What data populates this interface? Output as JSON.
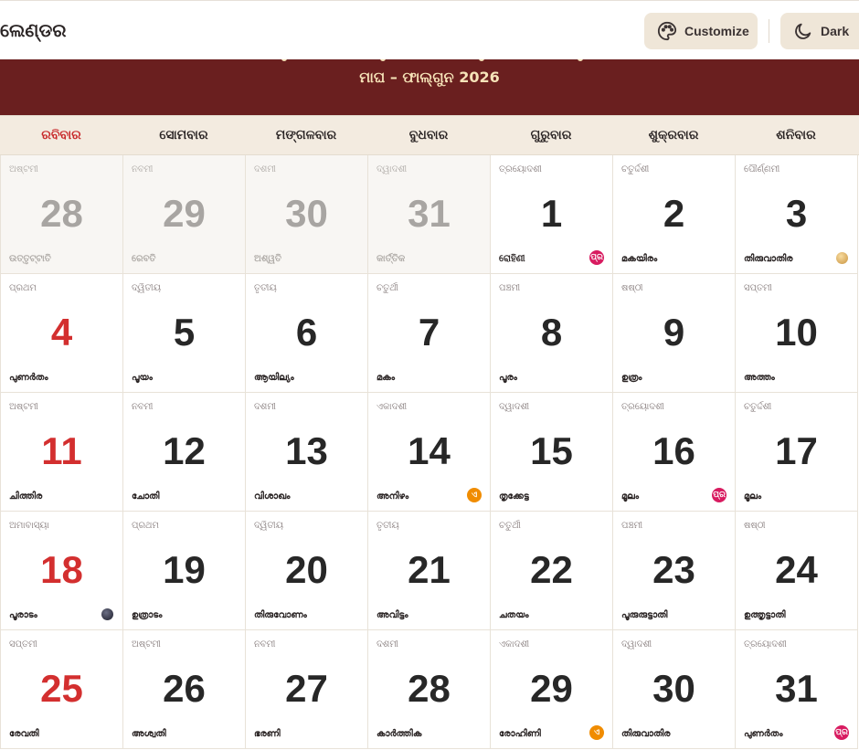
{
  "header": {
    "title": "ଲେଣ୍ଡର",
    "customize_label": "Customize",
    "dark_label": "Dark"
  },
  "banner": {
    "subtitle": "ମାଘ – ଫାଲ୍‌ଗୁନ 2026"
  },
  "colors": {
    "banner": "#6a1f1f",
    "banner_text": "#f6e3b8",
    "sunday_red": "#d32f2f",
    "badge_pink": "#d81b60",
    "badge_orange": "#f08c00",
    "button_bg": "#efe6d8"
  },
  "weekdays": [
    "ରବିବାର",
    "ସୋମବାର",
    "ମଙ୍ଗଳବାର",
    "ବୁଧବାର",
    "ଗୁରୁବାର",
    "ଶୁକ୍ରବାର",
    "ଶନିବାର"
  ],
  "days": [
    {
      "day": "28",
      "tithi": "ଅଷ୍ଟମୀ",
      "nakshatra": "ଉତ୍ତୃଟ୍ଟାତି",
      "other_month": true
    },
    {
      "day": "29",
      "tithi": "ନବମୀ",
      "nakshatra": "ରେବତି",
      "other_month": true
    },
    {
      "day": "30",
      "tithi": "ଦଶମୀ",
      "nakshatra": "ଅଶ୍ୱତି",
      "other_month": true
    },
    {
      "day": "31",
      "tithi": "ଦ୍ୱାଦଶୀ",
      "nakshatra": "କାର୍ତ୍ତିକ",
      "other_month": true
    },
    {
      "day": "1",
      "tithi": "ତ୍ରୟୋଦଶୀ",
      "nakshatra": "ରୋହିଣୀ",
      "badge": "ପ୍ର",
      "badge_color": "pink"
    },
    {
      "day": "2",
      "tithi": "ଚତୁର୍ଦ୍ଦଶୀ",
      "nakshatra": "മകയിരം"
    },
    {
      "day": "3",
      "tithi": "ପୌର୍ଣ୍ଣମୀ",
      "nakshatra": "തിരുവാതിര",
      "moon": "full"
    },
    {
      "day": "4",
      "tithi": "ପ୍ରଥମ",
      "nakshatra": "പുണർതം"
    },
    {
      "day": "5",
      "tithi": "ଦ୍ୱିତୀୟ",
      "nakshatra": "പൂയം"
    },
    {
      "day": "6",
      "tithi": "ତୃତୀୟ",
      "nakshatra": "ആയില്യം"
    },
    {
      "day": "7",
      "tithi": "ଚତୁର୍ଥୀ",
      "nakshatra": "മകം"
    },
    {
      "day": "8",
      "tithi": "ପଞ୍ଚମୀ",
      "nakshatra": "പൂരം"
    },
    {
      "day": "9",
      "tithi": "ଷଷ୍ଠୀ",
      "nakshatra": "ഉത്രം"
    },
    {
      "day": "10",
      "tithi": "ସପ୍ତମୀ",
      "nakshatra": "അത്തം"
    },
    {
      "day": "11",
      "tithi": "ଅଷ୍ଟମୀ",
      "nakshatra": "ചിത്തിര"
    },
    {
      "day": "12",
      "tithi": "ନବମୀ",
      "nakshatra": "ചോതി"
    },
    {
      "day": "13",
      "tithi": "ଦଶମୀ",
      "nakshatra": "വിശാഖം"
    },
    {
      "day": "14",
      "tithi": "ଏକାଦଶୀ",
      "nakshatra": "അനിഴം",
      "badge": "ଏ",
      "badge_color": "orange"
    },
    {
      "day": "15",
      "tithi": "ଦ୍ୱାଦଶୀ",
      "nakshatra": "തൃക്കേട്ട"
    },
    {
      "day": "16",
      "tithi": "ତ୍ରୟୋଦଶୀ",
      "nakshatra": "മൂലം",
      "badge": "ପ୍ର",
      "badge_color": "pink"
    },
    {
      "day": "17",
      "tithi": "ଚତୁର୍ଦ୍ଦଶୀ",
      "nakshatra": "മൂലം"
    },
    {
      "day": "18",
      "tithi": "ଅମାବାସ୍ୟା",
      "nakshatra": "പൂരാടം",
      "moon": "new"
    },
    {
      "day": "19",
      "tithi": "ପ୍ରଥମ",
      "nakshatra": "ഉത്രാടം"
    },
    {
      "day": "20",
      "tithi": "ଦ୍ୱିତୀୟ",
      "nakshatra": "തിരുവോണം"
    },
    {
      "day": "21",
      "tithi": "ତୃତୀୟ",
      "nakshatra": "അവിട്ടം"
    },
    {
      "day": "22",
      "tithi": "ଚତୁର୍ଥୀ",
      "nakshatra": "ചതയം"
    },
    {
      "day": "23",
      "tithi": "ପଞ୍ଚମୀ",
      "nakshatra": "പൂരുരുട്ടാതി"
    },
    {
      "day": "24",
      "tithi": "ଷଷ୍ଠୀ",
      "nakshatra": "ഉത്തൃട്ടാതി"
    },
    {
      "day": "25",
      "tithi": "ସପ୍ତମୀ",
      "nakshatra": "രേവതി"
    },
    {
      "day": "26",
      "tithi": "ଅଷ୍ଟମୀ",
      "nakshatra": "അശ്വതി"
    },
    {
      "day": "27",
      "tithi": "ନବମୀ",
      "nakshatra": "ഭരണി"
    },
    {
      "day": "28",
      "tithi": "ଦଶମୀ",
      "nakshatra": "കാർത്തിക"
    },
    {
      "day": "29",
      "tithi": "ଏକାଦଶୀ",
      "nakshatra": "രോഹിണി",
      "badge": "ଏ",
      "badge_color": "orange"
    },
    {
      "day": "30",
      "tithi": "ଦ୍ୱାଦଶୀ",
      "nakshatra": "തിരുവാതിര"
    },
    {
      "day": "31",
      "tithi": "ତ୍ରୟୋଦଶୀ",
      "nakshatra": "പുണർതം",
      "badge": "ପ୍ର",
      "badge_color": "pink"
    }
  ]
}
